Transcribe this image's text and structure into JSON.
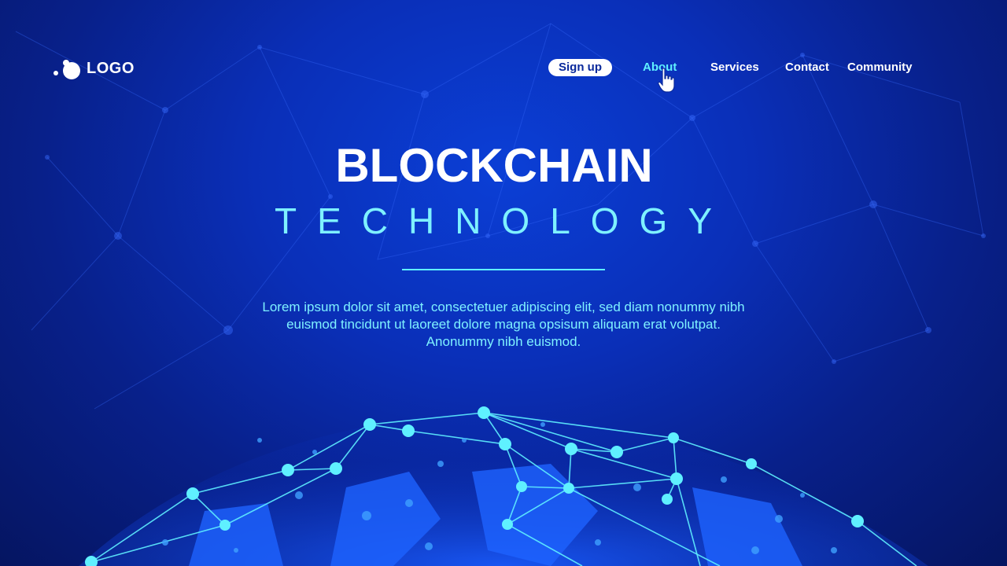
{
  "logo": {
    "text": "LOGO"
  },
  "nav": {
    "items": [
      {
        "label": "Sign up"
      },
      {
        "label": "About"
      },
      {
        "label": "Services"
      },
      {
        "label": "Contact"
      },
      {
        "label": "Community"
      }
    ],
    "active": "About"
  },
  "hero": {
    "title": "BLOCKCHAIN",
    "subtitle": "TECHNOLOGY",
    "body": "Lorem ipsum dolor sit amet, consectetuer adipiscing elit, sed diam nonummy nibh euismod tincidunt ut laoreet dolore magna opsisum aliquam erat volutpat. Anonummy nibh euismod."
  },
  "colors": {
    "background": "#0a2fb8",
    "accent": "#5ff0ff",
    "text": "#ffffff"
  },
  "icons": {
    "cursor": "hand-pointer-icon",
    "logo": "logo-dots-icon"
  }
}
